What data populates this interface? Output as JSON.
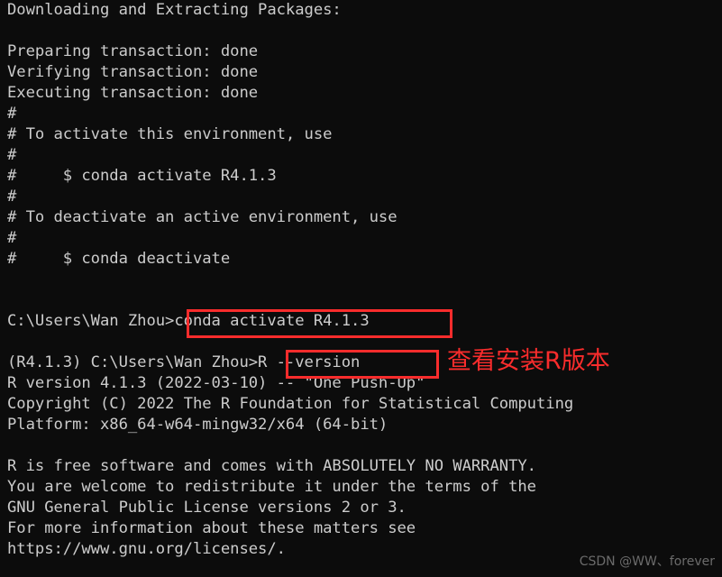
{
  "terminal": {
    "background_color": "#0c0c0c",
    "foreground_color": "#cccccc",
    "console_output": "Downloading and Extracting Packages:\n\nPreparing transaction: done\nVerifying transaction: done\nExecuting transaction: done\n#\n# To activate this environment, use\n#\n#     $ conda activate R4.1.3\n#\n# To deactivate an active environment, use\n#\n#     $ conda deactivate\n\n\nC:\\Users\\Wan Zhou>conda activate R4.1.3\n\n(R4.1.3) C:\\Users\\Wan Zhou>R --version\nR version 4.1.3 (2022-03-10) -- \"One Push-Up\"\nCopyright (C) 2022 The R Foundation for Statistical Computing\nPlatform: x86_64-w64-mingw32/x64 (64-bit)\n\nR is free software and comes with ABSOLUTELY NO WARRANTY.\nYou are welcome to redistribute it under the terms of the\nGNU General Public License versions 2 or 3.\nFor more information about these matters see\nhttps://www.gnu.org/licenses/.",
    "lines": [
      "Downloading and Extracting Packages:",
      "",
      "Preparing transaction: done",
      "Verifying transaction: done",
      "Executing transaction: done",
      "#",
      "# To activate this environment, use",
      "#",
      "#     $ conda activate R4.1.3",
      "#",
      "# To deactivate an active environment, use",
      "#",
      "#     $ conda deactivate",
      "",
      "",
      "C:\\Users\\Wan Zhou>conda activate R4.1.3",
      "",
      "(R4.1.3) C:\\Users\\Wan Zhou>R --version",
      "R version 4.1.3 (2022-03-10) -- \"One Push-Up\"",
      "Copyright (C) 2022 The R Foundation for Statistical Computing",
      "Platform: x86_64-w64-mingw32/x64 (64-bit)",
      "",
      "R is free software and comes with ABSOLUTELY NO WARRANTY.",
      "You are welcome to redistribute it under the terms of the",
      "GNU General Public License versions 2 or 3.",
      "For more information about these matters see",
      "https://www.gnu.org/licenses/."
    ]
  },
  "annotations": {
    "color": "#f92c2c",
    "box_activate_command": ">conda activate R4.1.3",
    "box_version_command": ">R --version",
    "note_text": "查看安装R版本"
  },
  "watermark": {
    "text": "CSDN @WW、forever",
    "color": "#6b6b6b"
  }
}
